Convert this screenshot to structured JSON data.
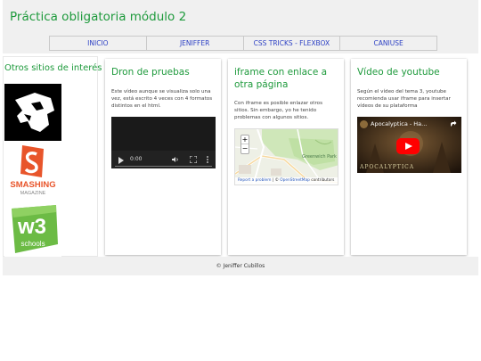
{
  "header": {
    "title": "Práctica obligatoria módulo 2",
    "nav": [
      "INICIO",
      "JENIFFER",
      "CSS TRICKS - FLEXBOX",
      "CANIUSE"
    ]
  },
  "sidebar": {
    "title": "Otros sitios de interés",
    "logos": [
      {
        "name": "codepen-logo",
        "icon": "lion-head-icon"
      },
      {
        "name": "smashing-magazine-logo",
        "text": "SMASHING",
        "subtext": "MAGAZINE"
      },
      {
        "name": "w3schools-logo",
        "text": "w3",
        "subtext": "schools"
      }
    ]
  },
  "cards": [
    {
      "title": "Dron de pruebas",
      "text": "Este vídeo aunque se visualiza solo una vez, está escrito 4 veces con 4 formatos distintos en el html.",
      "video": {
        "time": "0:00"
      }
    },
    {
      "title": "iframe con enlace a otra página",
      "text": "Con iframe es posible enlazar otros sitios. Sin embargo, yo he tenido problemas con algunos sitios.",
      "map": {
        "zoom_in": "+",
        "zoom_out": "−",
        "park_label": "Greenwich Park",
        "attribution_report": "Report a problem",
        "attribution_sep": " | © ",
        "attribution_osm": "OpenStreetMap",
        "attribution_tail": " contributors"
      }
    },
    {
      "title": "Vídeo de youtube",
      "text": "Según el vídeo del tema 3, youtube recomienda usar iframe para insertar vídeos de su plataforma",
      "youtube": {
        "title": "Apocalyptica - Ha...",
        "caption": "APOCALYPTICA"
      }
    }
  ],
  "footer": {
    "text": "© Jeniffer Cubillos"
  },
  "colors": {
    "accent_green": "#1e9a3c",
    "nav_link": "#2b3fc4",
    "youtube_red": "#ff0000"
  }
}
